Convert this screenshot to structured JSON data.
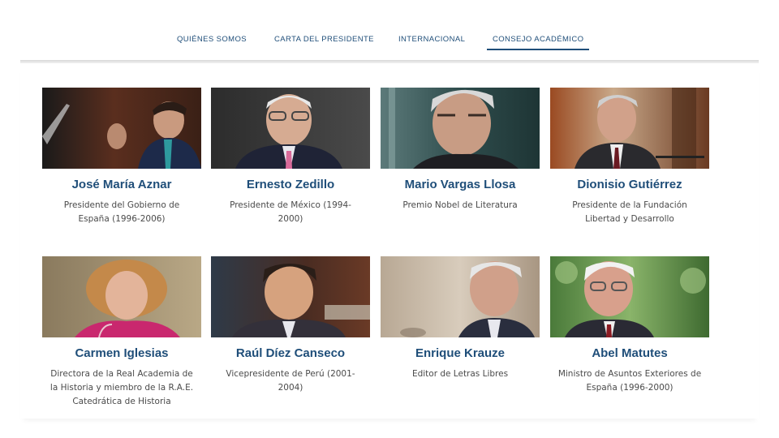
{
  "nav": {
    "items": [
      {
        "label": "QUIÉNES SOMOS"
      },
      {
        "label": "CARTA DEL PRESIDENTE"
      },
      {
        "label": "INTERNACIONAL"
      },
      {
        "label": "CONSEJO ACADÉMICO",
        "active": true
      }
    ]
  },
  "members": [
    {
      "name": "José María Aznar",
      "role": "Presidente del Gobierno de España (1996-2006)"
    },
    {
      "name": "Ernesto Zedillo",
      "role": "Presidente de México (1994-2000)"
    },
    {
      "name": "Mario Vargas Llosa",
      "role": "Premio Nobel de Literatura"
    },
    {
      "name": "Dionisio Gutiérrez",
      "role": "Presidente de la Fundación Libertad y Desarrollo"
    },
    {
      "name": "Carmen Iglesias",
      "role": "Directora de la Real Academia de la Historia y miembro de la R.A.E. Catedrática de Historia"
    },
    {
      "name": "Raúl Díez Canseco",
      "role": "Vicepresidente de Perú (2001-2004)"
    },
    {
      "name": "Enrique Krauze",
      "role": "Editor de Letras Libres"
    },
    {
      "name": "Abel Matutes",
      "role": "Ministro de Asuntos Exteriores de España (1996-2000)"
    }
  ],
  "colors": {
    "accent": "#1f4e79",
    "text": "#4a4a4a"
  }
}
